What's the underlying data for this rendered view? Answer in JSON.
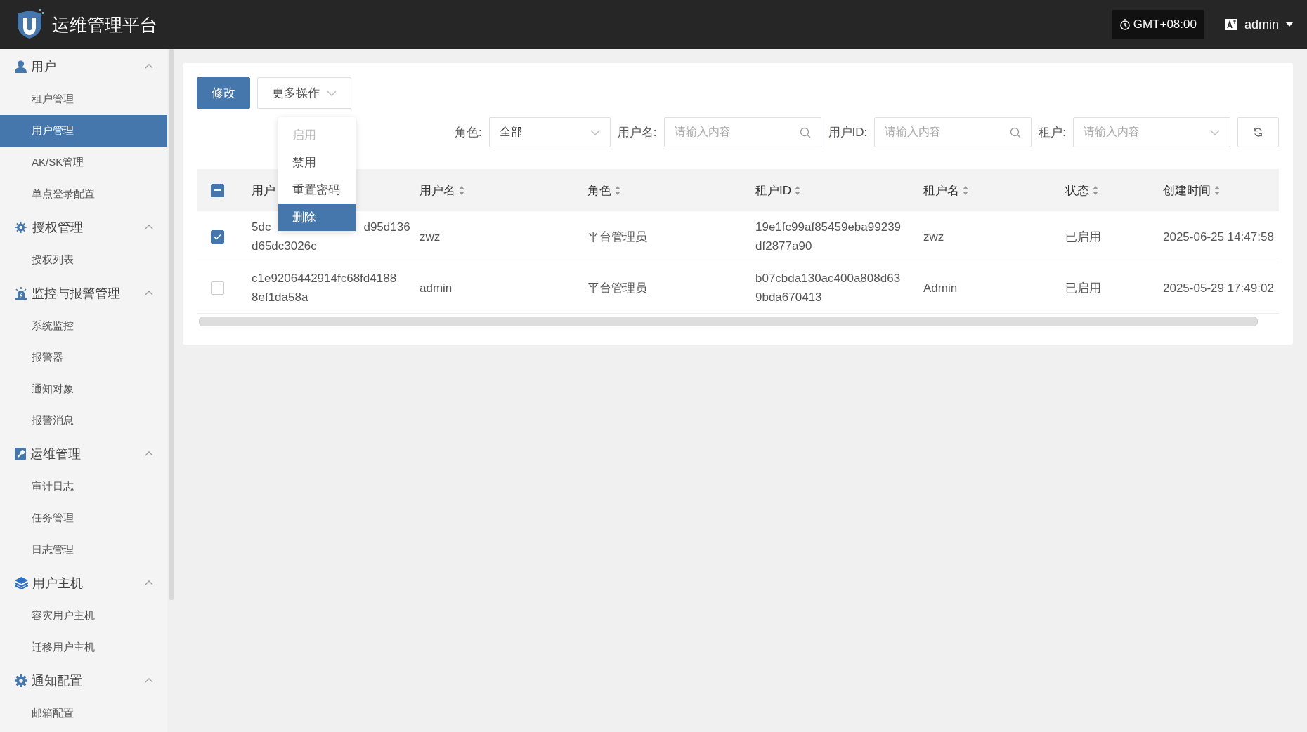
{
  "header": {
    "title": "运维管理平台",
    "timezone": "GMT+08:00",
    "user": "admin"
  },
  "sidebar": {
    "groups": [
      {
        "label": "用户",
        "expanded": true,
        "children": [
          {
            "label": "租户管理",
            "selected": false
          },
          {
            "label": "用户管理",
            "selected": true
          },
          {
            "label": "AK/SK管理",
            "selected": false
          },
          {
            "label": "单点登录配置",
            "selected": false
          }
        ]
      },
      {
        "label": "授权管理",
        "expanded": true,
        "children": [
          {
            "label": "授权列表",
            "selected": false
          }
        ]
      },
      {
        "label": "监控与报警管理",
        "expanded": true,
        "children": [
          {
            "label": "系统监控",
            "selected": false
          },
          {
            "label": "报警器",
            "selected": false
          },
          {
            "label": "通知对象",
            "selected": false
          },
          {
            "label": "报警消息",
            "selected": false
          }
        ]
      },
      {
        "label": "运维管理",
        "expanded": true,
        "children": [
          {
            "label": "审计日志",
            "selected": false
          },
          {
            "label": "任务管理",
            "selected": false
          },
          {
            "label": "日志管理",
            "selected": false
          }
        ]
      },
      {
        "label": "用户主机",
        "expanded": true,
        "children": [
          {
            "label": "容灾用户主机",
            "selected": false
          },
          {
            "label": "迁移用户主机",
            "selected": false
          }
        ]
      },
      {
        "label": "通知配置",
        "expanded": true,
        "children": [
          {
            "label": "邮箱配置",
            "selected": false
          }
        ]
      }
    ]
  },
  "toolbar": {
    "buttons": [
      {
        "label": "修改",
        "kind": "primary"
      },
      {
        "label": "更多操作",
        "kind": "dropdown"
      }
    ],
    "menu": [
      {
        "label": "启用",
        "disabled": true,
        "selected": false
      },
      {
        "label": "禁用",
        "disabled": false,
        "selected": false
      },
      {
        "label": "重置密码",
        "disabled": false,
        "selected": false
      },
      {
        "label": "删除",
        "disabled": false,
        "selected": true
      }
    ]
  },
  "filters": [
    {
      "label": "角色:",
      "kind": "select",
      "value": "全部"
    },
    {
      "label": "用户名:",
      "kind": "search",
      "placeholder": "请输入内容"
    },
    {
      "label": "用户ID:",
      "kind": "search",
      "placeholder": "请输入内容"
    },
    {
      "label": "租户:",
      "kind": "select",
      "placeholder": "请输入内容"
    }
  ],
  "table": {
    "select_all": {
      "indeterminate": true
    },
    "columns": [
      {
        "label": "用户",
        "sortable": false
      },
      {
        "label": "用户名",
        "sortable": true
      },
      {
        "label": "角色",
        "sortable": true
      },
      {
        "label": "租户ID",
        "sortable": true
      },
      {
        "label": "租户名",
        "sortable": true
      },
      {
        "label": "状态",
        "sortable": true
      },
      {
        "label": "创建时间",
        "sortable": true
      }
    ],
    "rows": [
      {
        "selected": true,
        "cells": [
          {
            "lines": [
              [
                "5dc",
                "d95d136"
              ],
              [
                "d65dc3026c"
              ]
            ]
          },
          "zwz",
          "平台管理员",
          {
            "lines": [
              [
                "19e1fc99af85459eba99239"
              ],
              [
                "df2877a90"
              ]
            ]
          },
          "zwz",
          "已启用",
          "2025-06-25 14:47:58"
        ]
      },
      {
        "selected": false,
        "cells": [
          {
            "lines": [
              [
                "c1e9206442914fc68fd4188"
              ],
              [
                "8ef1da58a"
              ]
            ]
          },
          "admin",
          "平台管理员",
          {
            "lines": [
              [
                "b07cbda130ac400a808d63"
              ],
              [
                "9bda670413"
              ]
            ]
          },
          "Admin",
          "已启用",
          "2025-05-29 17:49:02"
        ]
      }
    ]
  }
}
